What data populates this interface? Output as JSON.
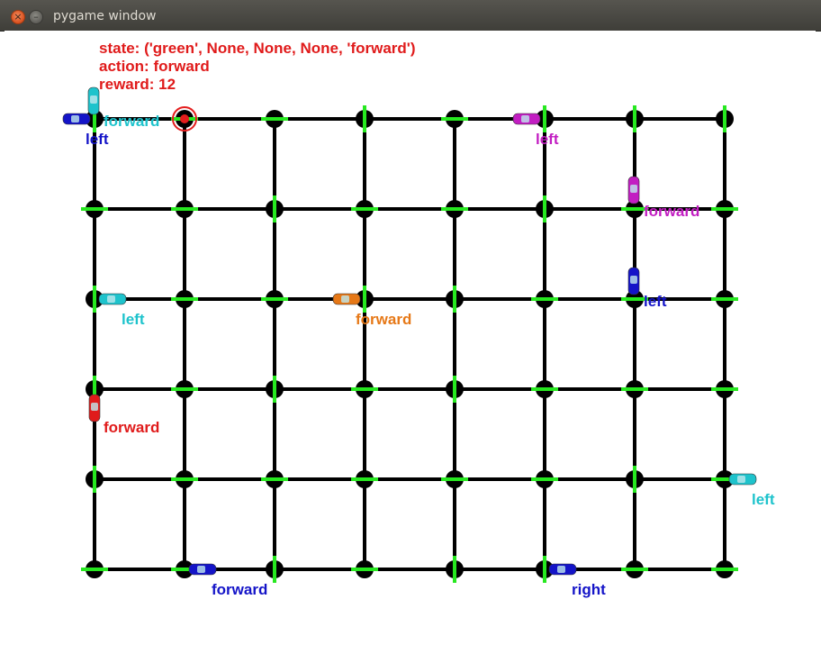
{
  "window": {
    "title": "pygame window",
    "close_label": "×",
    "minimize_label": "–"
  },
  "hud": {
    "state": "state: ('green', None, None, None, 'forward')",
    "action": "action: forward",
    "reward": "reward: 12"
  },
  "colors": {
    "road": "#000000",
    "signal": "#27e820",
    "target": "#e41d1d",
    "red": "#e01b1b",
    "cyan": "#1ec3cc",
    "blue": "#1414c8",
    "magenta": "#c21ec2",
    "orange": "#e67817"
  },
  "grid": {
    "columns": 8,
    "rows": 6
  },
  "cars": [
    {
      "id": "car-blue-topleft",
      "color": "blue",
      "label": "left"
    },
    {
      "id": "car-cyan-topleft",
      "color": "cyan",
      "label": "forward"
    },
    {
      "id": "car-magenta-top",
      "color": "magenta",
      "label": "left"
    },
    {
      "id": "car-magenta-right",
      "color": "magenta",
      "label": "forward"
    },
    {
      "id": "car-blue-right",
      "color": "blue",
      "label": "left"
    },
    {
      "id": "car-cyan-mid",
      "color": "cyan",
      "label": "left"
    },
    {
      "id": "car-orange",
      "color": "orange",
      "label": "forward"
    },
    {
      "id": "car-red-agent",
      "color": "red",
      "label": "forward"
    },
    {
      "id": "car-cyan-edge",
      "color": "cyan",
      "label": "left"
    },
    {
      "id": "car-blue-bottom",
      "color": "blue",
      "label": "forward"
    },
    {
      "id": "car-blue-bottomright",
      "color": "blue",
      "label": "right"
    }
  ]
}
